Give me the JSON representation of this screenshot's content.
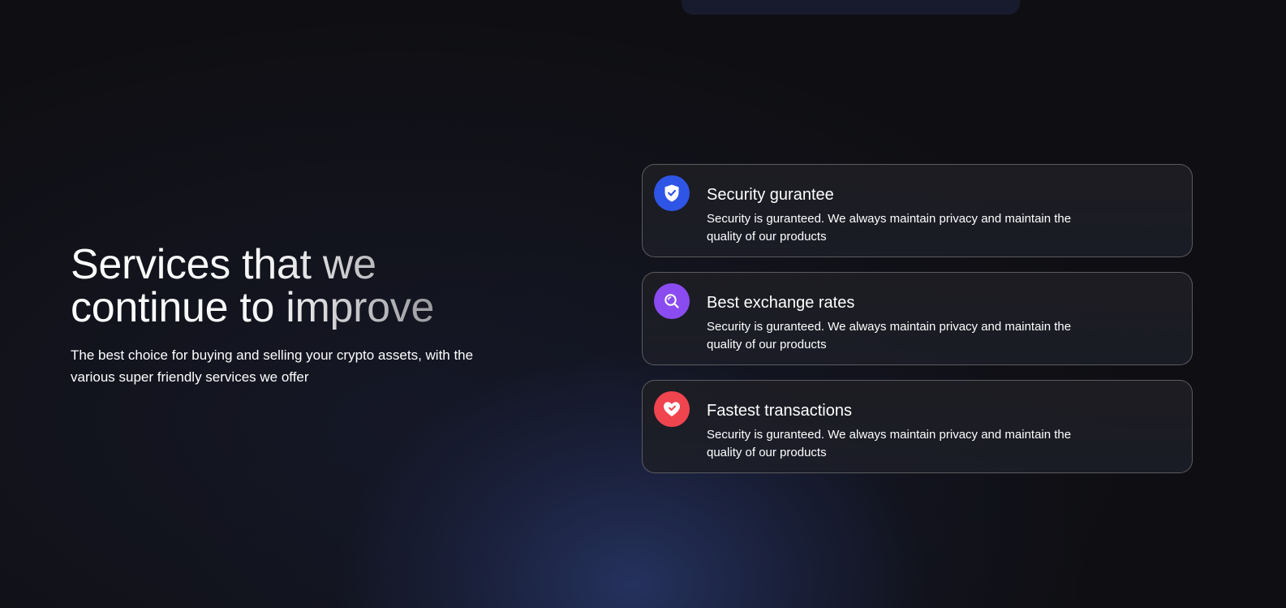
{
  "hero": {
    "title_line1": "Services that we",
    "title_line2": "continue to improve",
    "subtitle": "The best choice for buying and selling your crypto assets, with the various super friendly services we offer"
  },
  "features": [
    {
      "title": "Security gurantee",
      "description": "Security is guranteed. We always maintain privacy and maintain the quality of our products",
      "icon": "shield-check-icon",
      "icon_color": "#2f55e6"
    },
    {
      "title": "Best exchange rates",
      "description": "Security is guranteed. We always maintain privacy and maintain the quality of our products",
      "icon": "magnifier-icon",
      "icon_color": "#8a4cf0"
    },
    {
      "title": "Fastest transactions",
      "description": "Security is guranteed. We always maintain privacy and maintain the quality of our products",
      "icon": "heart-icon",
      "icon_color": "#f0444f"
    }
  ],
  "colors": {
    "background": "#0f0f13",
    "glow": "#283769",
    "card_border": "#5a5a60"
  }
}
